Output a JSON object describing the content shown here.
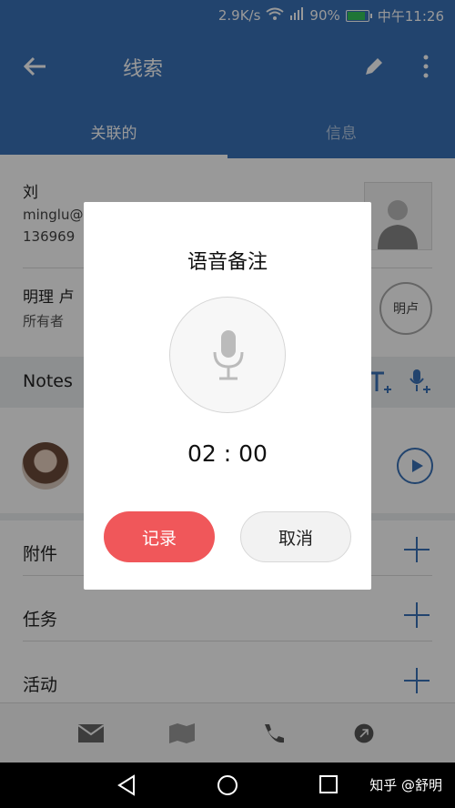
{
  "status_bar": {
    "speed": "2.9K/s",
    "battery": "90%",
    "battery_level": 0.9,
    "time": "中午11:26"
  },
  "app_bar": {
    "title": "线索"
  },
  "tabs": [
    {
      "label": "关联的",
      "active": true
    },
    {
      "label": "信息",
      "active": false
    }
  ],
  "contact": {
    "name": "刘",
    "email": "minglu@",
    "phone": "136969"
  },
  "owner": {
    "name": "明理 卢",
    "role": "所有者",
    "badge": "明卢"
  },
  "notes": {
    "title": "Notes"
  },
  "rows": [
    {
      "label": "附件"
    },
    {
      "label": "任务"
    },
    {
      "label": "活动"
    }
  ],
  "watermark": "知乎 @舒明",
  "dialog": {
    "title": "语音备注",
    "timer": "02 : 00",
    "record_label": "记录",
    "cancel_label": "取消"
  },
  "colors": {
    "primary": "#3a72b8",
    "record": "#f0575a"
  }
}
